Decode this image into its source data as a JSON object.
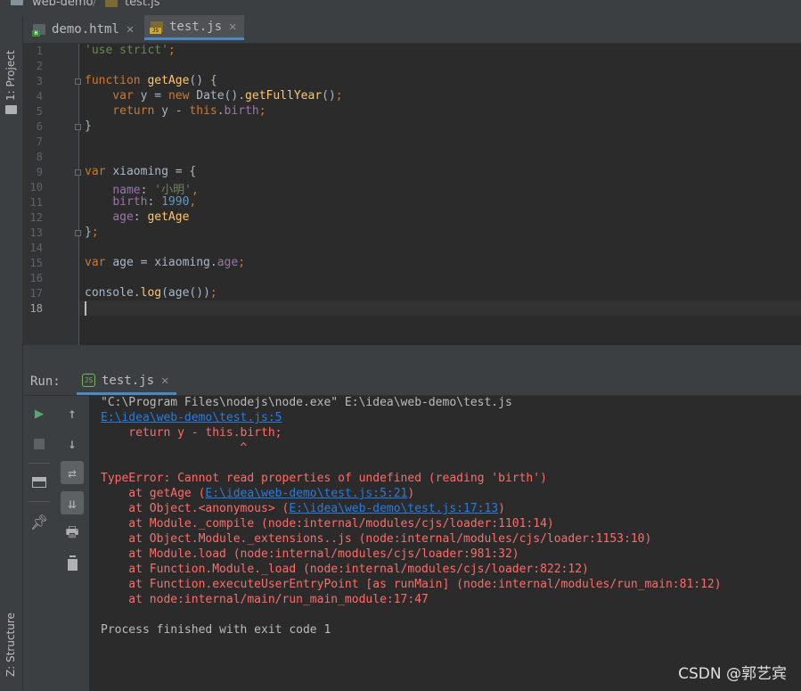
{
  "breadcrumb": {
    "project": "web-demo",
    "separator": "/",
    "file": "test.js"
  },
  "left_strip": {
    "project_label": "1: Project",
    "structure_label": "Z: Structure"
  },
  "tabs": [
    {
      "label": "demo.html",
      "icon": "html-file-icon",
      "active": false
    },
    {
      "label": "test.js",
      "icon": "js-file-icon",
      "active": true
    }
  ],
  "editor": {
    "line_numbers": [
      "1",
      "2",
      "3",
      "4",
      "5",
      "6",
      "7",
      "8",
      "9",
      "10",
      "11",
      "12",
      "13",
      "14",
      "15",
      "16",
      "17",
      "18"
    ],
    "current_line": 18,
    "lines": [
      [
        [
          "'use strict'",
          "str"
        ],
        [
          ";",
          "kw"
        ]
      ],
      [],
      [
        [
          "function ",
          "kw"
        ],
        [
          "getAge",
          "fn"
        ],
        [
          "() {",
          "plain"
        ]
      ],
      [
        [
          "    var ",
          "kw"
        ],
        [
          "y = ",
          "plain"
        ],
        [
          "new ",
          "kw"
        ],
        [
          "Date().",
          "plain"
        ],
        [
          "getFullYear",
          "fn"
        ],
        [
          "()",
          "plain"
        ],
        [
          ";",
          "kw"
        ]
      ],
      [
        [
          "    return ",
          "kw"
        ],
        [
          "y - ",
          "plain"
        ],
        [
          "this",
          "kw"
        ],
        [
          ".",
          "plain"
        ],
        [
          "birth",
          "prop"
        ],
        [
          ";",
          "kw"
        ]
      ],
      [
        [
          "}",
          "plain"
        ]
      ],
      [],
      [],
      [
        [
          "var ",
          "kw"
        ],
        [
          "xiaoming = {",
          "plain"
        ]
      ],
      [
        [
          "    ",
          "plain"
        ],
        [
          "name",
          "prop"
        ],
        [
          ": ",
          "plain"
        ],
        [
          "'小明'",
          "str"
        ],
        [
          ",",
          "kw"
        ]
      ],
      [
        [
          "    ",
          "plain"
        ],
        [
          "birth",
          "prop"
        ],
        [
          ": ",
          "plain"
        ],
        [
          "1990",
          "num"
        ],
        [
          ",",
          "kw"
        ]
      ],
      [
        [
          "    ",
          "plain"
        ],
        [
          "age",
          "prop"
        ],
        [
          ": ",
          "plain"
        ],
        [
          "getAge",
          "fn"
        ]
      ],
      [
        [
          "}",
          "plain"
        ],
        [
          ";",
          "kw"
        ]
      ],
      [],
      [
        [
          "var ",
          "kw"
        ],
        [
          "age = xiaoming.",
          "plain"
        ],
        [
          "age",
          "prop"
        ],
        [
          ";",
          "kw"
        ]
      ],
      [],
      [
        [
          "console.",
          "plain"
        ],
        [
          "log",
          "fn"
        ],
        [
          "(age())",
          "plain"
        ],
        [
          ";",
          "kw"
        ]
      ],
      []
    ]
  },
  "run_panel": {
    "label": "Run:",
    "tab_label": "test.js"
  },
  "console": [
    {
      "text": "\"C:\\Program Files\\nodejs\\node.exe\" E:\\idea\\web-demo\\test.js",
      "style": "norm"
    },
    {
      "parts": [
        [
          "E:\\idea\\web-demo\\test.js:5",
          "link"
        ]
      ]
    },
    {
      "text": "    return y - this.birth;",
      "style": "err"
    },
    {
      "text": "                    ^",
      "style": "err"
    },
    {
      "text": "",
      "style": "norm"
    },
    {
      "text": "TypeError: Cannot read properties of undefined (reading 'birth')",
      "style": "err"
    },
    {
      "parts": [
        [
          "    at getAge (",
          "err"
        ],
        [
          "E:\\idea\\web-demo\\test.js:5:21",
          "link"
        ],
        [
          ")",
          "err"
        ]
      ]
    },
    {
      "parts": [
        [
          "    at Object.<anonymous> (",
          "err"
        ],
        [
          "E:\\idea\\web-demo\\test.js:17:13",
          "link"
        ],
        [
          ")",
          "err"
        ]
      ]
    },
    {
      "text": "    at Module._compile (node:internal/modules/cjs/loader:1101:14)",
      "style": "err"
    },
    {
      "text": "    at Object.Module._extensions..js (node:internal/modules/cjs/loader:1153:10)",
      "style": "err"
    },
    {
      "text": "    at Module.load (node:internal/modules/cjs/loader:981:32)",
      "style": "err"
    },
    {
      "text": "    at Function.Module._load (node:internal/modules/cjs/loader:822:12)",
      "style": "err"
    },
    {
      "text": "    at Function.executeUserEntryPoint [as runMain] (node:internal/modules/run_main:81:12)",
      "style": "err"
    },
    {
      "text": "    at node:internal/main/run_main_module:17:47",
      "style": "err"
    },
    {
      "text": "",
      "style": "norm"
    },
    {
      "text": "Process finished with exit code 1",
      "style": "norm"
    }
  ],
  "watermark": "CSDN @郭艺宾",
  "colors": {
    "keyword": "#cc7832",
    "string": "#6a8759",
    "function": "#ffc66d",
    "property": "#9876aa",
    "number": "#6897bb",
    "error": "#ff6b68",
    "link": "#287bde"
  }
}
